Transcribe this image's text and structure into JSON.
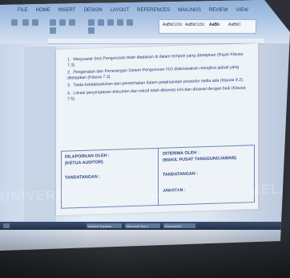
{
  "ribbon": {
    "tabs": [
      "FILE",
      "HOME",
      "INSERT",
      "DESIGN",
      "LAYOUT",
      "REFERENCES",
      "MAILINGS",
      "REVIEW",
      "VIEW"
    ],
    "styles": [
      "AaBbCcDc",
      "AaBbCcDc",
      "AaBb",
      "AaBbC"
    ]
  },
  "document": {
    "items": [
      {
        "num": "1.",
        "text": "Mesyuarat Sesi Pengurusan telah diadakan di dalam tempoh yang ditetapkan (Rujuk Klausa 7.3)."
      },
      {
        "num": "2.",
        "text": "Pengenalan dan Penerangan Sistem Pengurusan ISO dilaksanakan mengikut jadual yang ditetapkan (Klausa 7.3)."
      },
      {
        "num": "3.",
        "text": "Tiada ketidakpatuhan dan pemerhatian dalam pelaksanaan prosedur sedia ada (Klausa 9.2)."
      },
      {
        "num": "4.",
        "text": "Lokasi penyimpanan dokumen dan rekod telah dikemas kini dan dikawal dengan baik (Klausa 7.5)."
      }
    ],
    "signoff": {
      "left_title": "DILAPORKAN OLEH :",
      "left_sub": "(KETUA AUDITOR)",
      "left_sign": "TANDATANGAN :",
      "right_title": "DITERIMA OLEH :",
      "right_sub": "(WAKIL PUSAT TANGGUNGJAWAB)",
      "right_sign": "TANDATANGAN :",
      "right_position": "JAWATAN :"
    }
  },
  "taskbar": {
    "items": [
      "Internet Explorer",
      "Microsoft Word",
      "Document1"
    ]
  },
  "watermark": "UNIVERSITI TEKNIKAL MALAYSIA MELAKA"
}
